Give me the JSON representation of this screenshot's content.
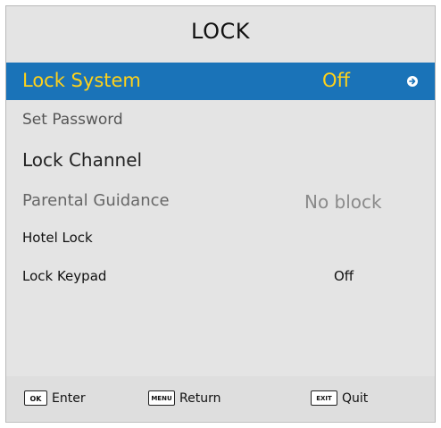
{
  "menu": {
    "title": "LOCK",
    "items": [
      {
        "label": "Lock System",
        "value": "Off"
      },
      {
        "label": "Set Password"
      },
      {
        "label": "Lock Channel"
      },
      {
        "label": "Parental Guidance",
        "value": "No block"
      },
      {
        "label": "Hotel Lock"
      },
      {
        "label": "Lock Keypad",
        "value": "Off"
      }
    ],
    "selected_icon": "arrow-right-icon"
  },
  "footer": {
    "ok": {
      "key": "OK",
      "label": "Enter"
    },
    "menu": {
      "key": "MENU",
      "label": "Return"
    },
    "exit": {
      "key": "EXIT",
      "label": "Quit"
    }
  },
  "colors": {
    "panel": "#e4e4e4",
    "highlight": "#1a73b8",
    "highlight_text": "#ffd21a"
  }
}
